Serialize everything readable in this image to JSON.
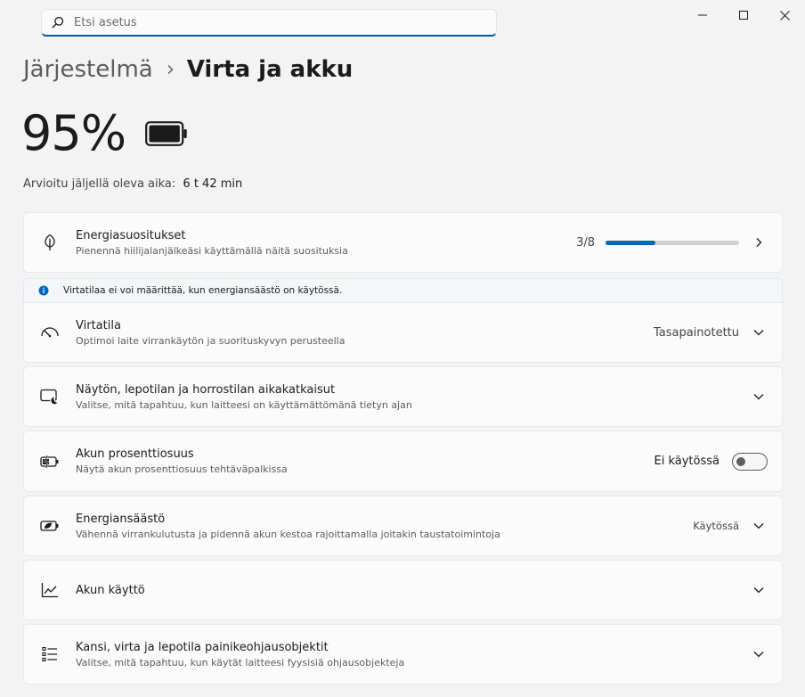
{
  "search": {
    "placeholder": "Etsi asetus"
  },
  "breadcrumb": {
    "parent": "Järjestelmä",
    "current": "Virta ja akku"
  },
  "battery": {
    "percent": "95%",
    "level": 0.95,
    "remaining_label": "Arvioitu jäljellä oleva aika:",
    "remaining_value": "6 t 42 min"
  },
  "energy_recommendations": {
    "title": "Energiasuositukset",
    "subtitle": "Pienennä hiilijalanjälkeäsi käyttämällä näitä suosituksia",
    "count": "3/8",
    "progress": 0.375
  },
  "info_banner": {
    "text": "Virtatilaa ei voi määrittää, kun energiansäästö on käytössä."
  },
  "power_mode": {
    "title": "Virtatila",
    "subtitle": "Optimoi laite virrankäytön ja suorituskyvyn perusteella",
    "value": "Tasapainotettu"
  },
  "screen_sleep": {
    "title": "Näytön, lepotilan ja horrostilan aikakatkaisut",
    "subtitle": "Valitse, mitä tapahtuu, kun laitteesi on käyttämättömänä tietyn ajan"
  },
  "battery_percentage": {
    "title": "Akun prosenttiosuus",
    "subtitle": "Näytä akun prosenttiosuus tehtäväpalkissa",
    "state": "Ei käytössä",
    "enabled": false
  },
  "energy_saver": {
    "title": "Energiansäästö",
    "subtitle": "Vähennä virrankulutusta ja pidennä akun kestoa rajoittamalla joitakin taustatoimintoja",
    "value": "Käytössä"
  },
  "battery_usage": {
    "title": "Akun käyttö"
  },
  "lid_power": {
    "title": "Kansi, virta ja lepotila painikeohjausobjektit",
    "subtitle": "Valitse, mitä tapahtuu, kun käytät laitteesi fyysisiä ohjausobjekteja"
  },
  "colors": {
    "accent": "#0067c0"
  }
}
